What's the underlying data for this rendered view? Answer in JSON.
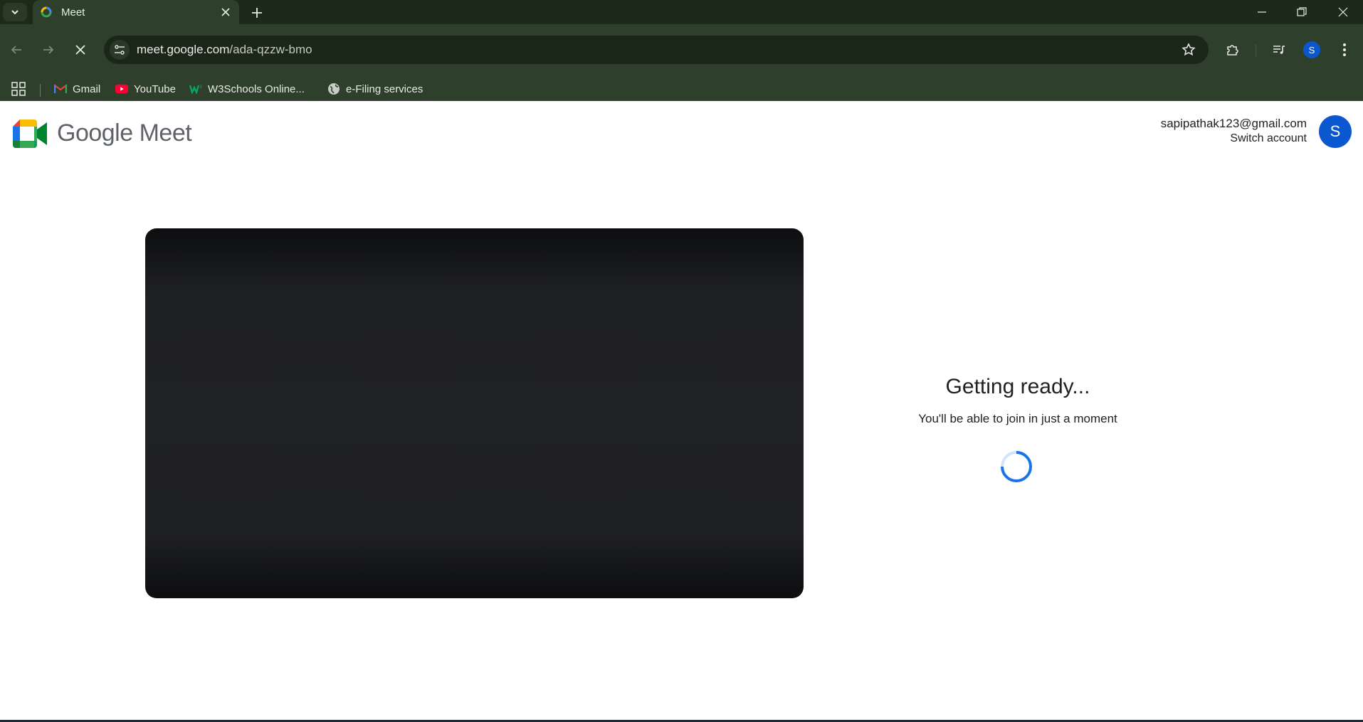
{
  "browser": {
    "tab": {
      "title": "Meet"
    },
    "address_bar": {
      "url_host": "meet.google.com",
      "url_path": "/ada-qzzw-bmo"
    },
    "profile_initial": "S",
    "bookmarks": [
      {
        "label": "Gmail",
        "icon": "gmail-icon"
      },
      {
        "label": "YouTube",
        "icon": "youtube-icon"
      },
      {
        "label": "W3Schools Online...",
        "icon": "w3schools-icon"
      },
      {
        "label": "e-Filing services",
        "icon": "globe-icon"
      }
    ]
  },
  "meet": {
    "brand": "Google Meet",
    "account": {
      "email": "sapipathak123@gmail.com",
      "switch_label": "Switch account",
      "avatar_initial": "S"
    },
    "status": {
      "heading": "Getting ready...",
      "subtext": "You'll be able to join in just a moment"
    }
  },
  "colors": {
    "accent": "#0b57d0",
    "chrome_frame": "#2e3f2b",
    "preview_bg": "#202124"
  }
}
